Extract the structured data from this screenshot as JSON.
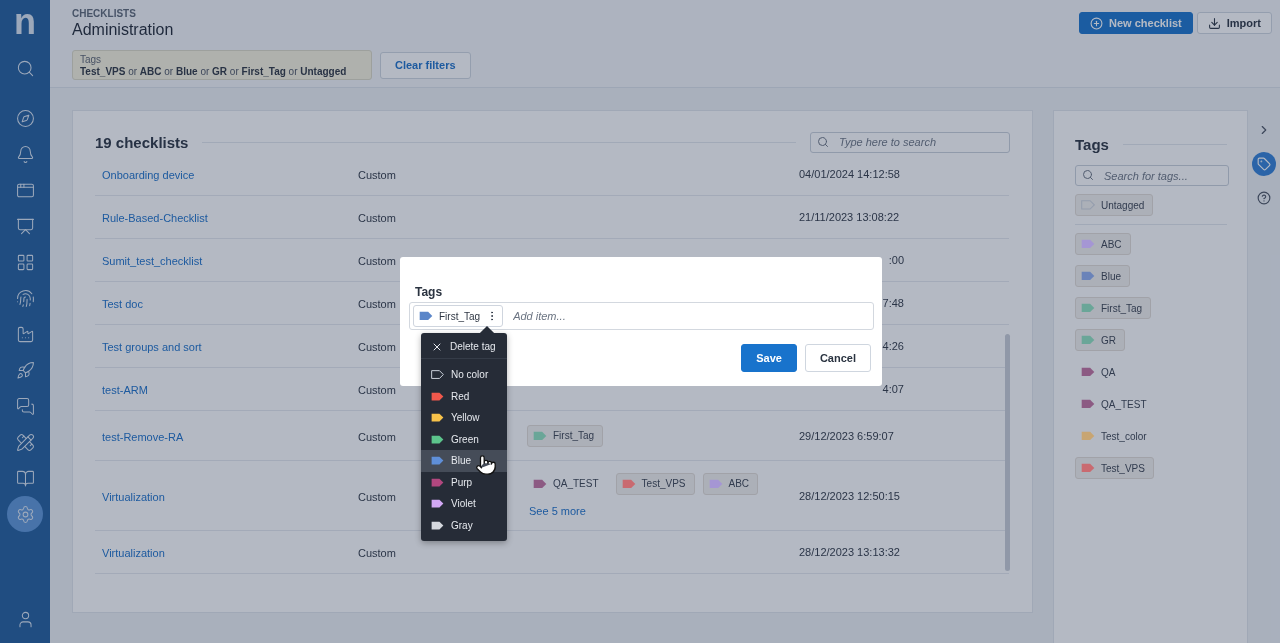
{
  "sidebar": {
    "logo": "n",
    "items": [
      {
        "selected": false
      },
      {
        "selected": false
      },
      {
        "selected": false
      },
      {
        "selected": false
      },
      {
        "selected": false
      },
      {
        "selected": false
      },
      {
        "selected": false
      },
      {
        "selected": false
      },
      {
        "selected": false
      },
      {
        "selected": false
      },
      {
        "selected": false
      },
      {
        "selected": false
      },
      {
        "selected": true
      }
    ]
  },
  "header": {
    "breadcrumb": "CHECKLISTS",
    "title": "Administration",
    "filter": {
      "label": "Tags",
      "value": "**Test_VPS** or **ABC** or **Blue** or **GR** or **First_Tag** or **Untagged**"
    },
    "clear_button": "Clear filters",
    "new_button": "New checklist",
    "import_button": "Import"
  },
  "table": {
    "title": "19 checklists",
    "search_placeholder": "Type here to search",
    "rows": [
      {
        "name": "Onboarding device",
        "type": "Custom",
        "tags": [],
        "date": "04/01/2024 14:12:58",
        "clipped": false
      },
      {
        "name": "Rule-Based-Checklist",
        "type": "Custom",
        "tags": [],
        "date": "21/11/2023 13:08:22",
        "clipped": false
      },
      {
        "name": "Sumit_test_checklist",
        "type": "Custom",
        "tags": [],
        "date": ":00",
        "clipped": true
      },
      {
        "name": "Test doc",
        "type": "Custom",
        "tags": [],
        "date": "7:48",
        "clipped": true
      },
      {
        "name": "Test groups and sort",
        "type": "Custom",
        "tags": [],
        "date": "4:26",
        "clipped": true
      },
      {
        "name": "test-ARM",
        "type": "Custom",
        "tags": [],
        "date": "4:07",
        "clipped": true
      },
      {
        "name": "test-Remove-RA",
        "type": "Custom",
        "tags": [
          {
            "label": "First_Tag",
            "color": "#6aa698",
            "selected": true
          }
        ],
        "date": "29/12/2023 6:59:07",
        "clipped": false
      },
      {
        "name": "Virtualization",
        "type": "Custom",
        "tags": [
          {
            "label": "QA_TEST",
            "color": "#8c5a83",
            "selected": false
          },
          {
            "label": "Test_VPS",
            "color": "#c96a70",
            "selected": true
          },
          {
            "label": "ABC",
            "color": "#a596d4",
            "selected": true
          }
        ],
        "more": "See 5 more",
        "date": "28/12/2023 12:50:15",
        "clipped": false
      },
      {
        "name": "Virtualization",
        "type": "Custom",
        "tags": [],
        "date": "28/12/2023 13:13:32",
        "clipped": false
      }
    ]
  },
  "tags_panel": {
    "title": "Tags",
    "search_placeholder": "Search for tags...",
    "untagged": {
      "label": "Untagged",
      "selected": true
    },
    "tags": [
      {
        "label": "ABC",
        "color": "#a596d4",
        "selected": true
      },
      {
        "label": "Blue",
        "color": "#6a83b9",
        "selected": true
      },
      {
        "label": "First_Tag",
        "color": "#6aa698",
        "selected": true
      },
      {
        "label": "GR",
        "color": "#6aa698",
        "selected": true
      },
      {
        "label": "QA",
        "color": "#8c5a83",
        "selected": false
      },
      {
        "label": "QA_TEST",
        "color": "#8c5a83",
        "selected": false
      },
      {
        "label": "Test_color",
        "color": "#c8a572",
        "selected": false
      },
      {
        "label": "Test_VPS",
        "color": "#c96a70",
        "selected": true
      }
    ]
  },
  "rail": {
    "items": [
      {
        "kind": "chevron",
        "selected": false
      },
      {
        "kind": "tag",
        "selected": true
      },
      {
        "kind": "help",
        "selected": false
      }
    ]
  },
  "modal": {
    "label": "Tags",
    "chip": {
      "label": "First_Tag",
      "color": "#5b86c9"
    },
    "placeholder": "Add item...",
    "save": "Save",
    "cancel": "Cancel",
    "menu": {
      "delete": "Delete tag",
      "items": [
        {
          "label": "No color",
          "highlighted": false
        },
        {
          "label": "Red",
          "color": "#f0584c",
          "highlighted": false
        },
        {
          "label": "Yellow",
          "color": "#f7c24a",
          "highlighted": false
        },
        {
          "label": "Green",
          "color": "#5cc48c",
          "highlighted": false
        },
        {
          "label": "Blue",
          "color": "#5f8fd8",
          "highlighted": true
        },
        {
          "label": "Purp",
          "color": "#b2477f",
          "highlighted": false
        },
        {
          "label": "Violet",
          "color": "#d2a8f5",
          "highlighted": false
        },
        {
          "label": "Gray",
          "color": "#d5d8de",
          "highlighted": false
        }
      ]
    }
  }
}
